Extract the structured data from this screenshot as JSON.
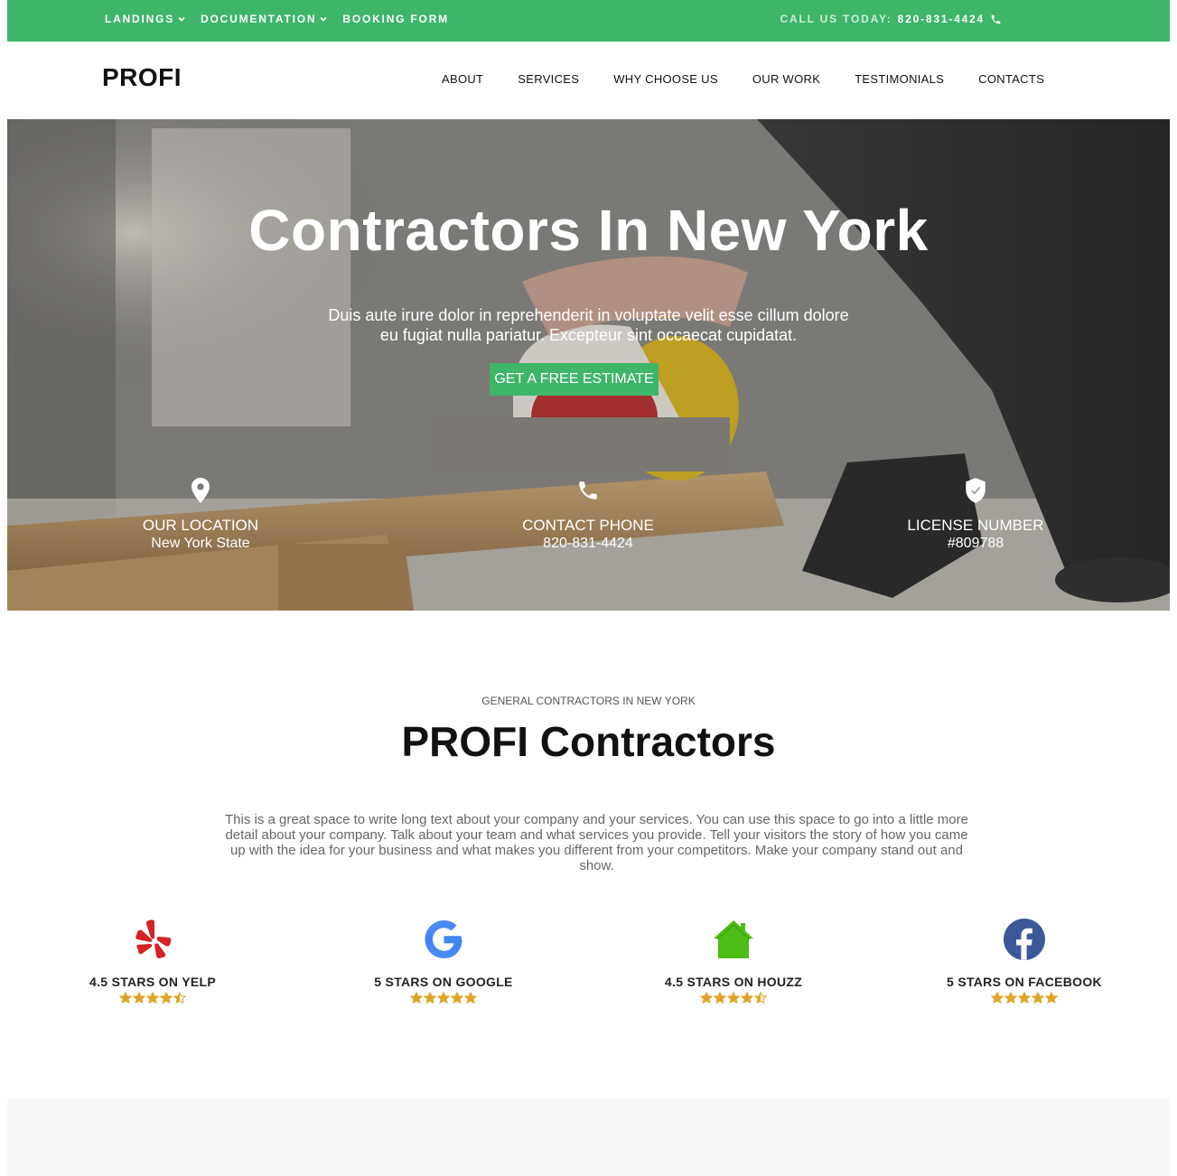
{
  "topbar": {
    "menu": [
      {
        "label": "LANDINGS",
        "dropdown": true
      },
      {
        "label": "DOCUMENTATION",
        "dropdown": true
      },
      {
        "label": "BOOKING FORM",
        "dropdown": false
      }
    ],
    "call_label": "CALL US TODAY:",
    "call_number": "820-831-4424"
  },
  "header": {
    "logo": "PROFI",
    "nav": [
      "ABOUT",
      "SERVICES",
      "WHY CHOOSE US",
      "OUR WORK",
      "TESTIMONIALS",
      "CONTACTS"
    ]
  },
  "hero": {
    "title": "Contractors In New York",
    "subtitle": "Duis aute irure dolor in reprehenderit in voluptate velit esse cillum dolore eu fugiat nulla pariatur. Excepteur sint occaecat cupidatat.",
    "cta_label": "GET A FREE ESTIMATE",
    "info": [
      {
        "icon": "location-pin-icon",
        "label": "OUR LOCATION",
        "value": "New York State"
      },
      {
        "icon": "phone-icon",
        "label": "CONTACT PHONE",
        "value": "820-831-4424"
      },
      {
        "icon": "shield-check-icon",
        "label": "LICENSE NUMBER",
        "value": "#809788"
      }
    ]
  },
  "about": {
    "eyebrow": "GENERAL CONTRACTORS IN NEW YORK",
    "title": "PROFI Contractors",
    "text": "This is a great space to write long text about your company and your services. You can use this space to go into a little more detail about your company. Talk about your team and what services you provide. Tell your visitors the story of how you came up with the idea for your business and what makes you different from your competitors. Make your company stand out and show."
  },
  "ratings": [
    {
      "icon": "yelp-icon",
      "label": "4.5 STARS ON YELP",
      "stars": 4.5
    },
    {
      "icon": "google-icon",
      "label": "5 STARS ON GOOGLE",
      "stars": 5
    },
    {
      "icon": "houzz-icon",
      "label": "4.5 STARS ON HOUZZ",
      "stars": 4.5
    },
    {
      "icon": "facebook-icon",
      "label": "5 STARS ON FACEBOOK",
      "stars": 5
    }
  ],
  "colors": {
    "brand_green": "#3fb56a",
    "star_gold": "#e0a526",
    "yelp_red": "#d32323",
    "google_blue": "#4285f4",
    "houzz_green": "#4dbc15",
    "facebook_blue": "#3b5998"
  }
}
